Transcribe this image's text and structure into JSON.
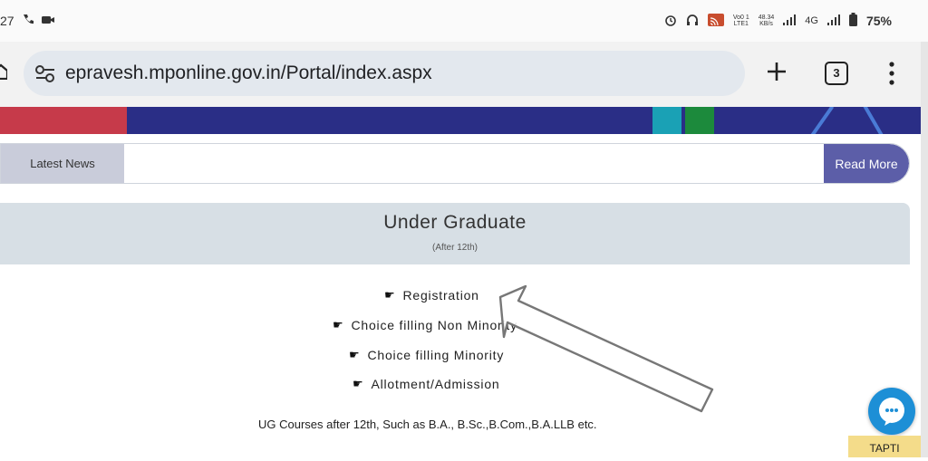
{
  "status_bar": {
    "time": "27",
    "battery": "75%",
    "network_label": "4G",
    "speed_value": "48.34",
    "speed_unit": "KB/s",
    "volte_line1": "Vo0 1",
    "volte_line2": "LTE1"
  },
  "browser": {
    "url": "epravesh.mponline.gov.in/Portal/index.aspx",
    "tab_count": "3"
  },
  "news": {
    "label": "Latest News",
    "read_more": "Read More"
  },
  "ug_card": {
    "title": "Under Graduate",
    "subtitle": "(After 12th)",
    "links": [
      "Registration",
      "Choice filling Non Minority",
      "Choice filling Minority",
      "Allotment/Admission"
    ],
    "description": "UG Courses after 12th, Such as B.A., B.Sc.,B.Com.,B.A.LLB etc."
  },
  "chat": {
    "badge": "TAPTI"
  },
  "colors": {
    "banner": "#2a2e86",
    "read_more": "#5c5ea8",
    "card_header": "#d7dfe5",
    "chat": "#1d8fd6",
    "badge": "#f4dc8a"
  }
}
